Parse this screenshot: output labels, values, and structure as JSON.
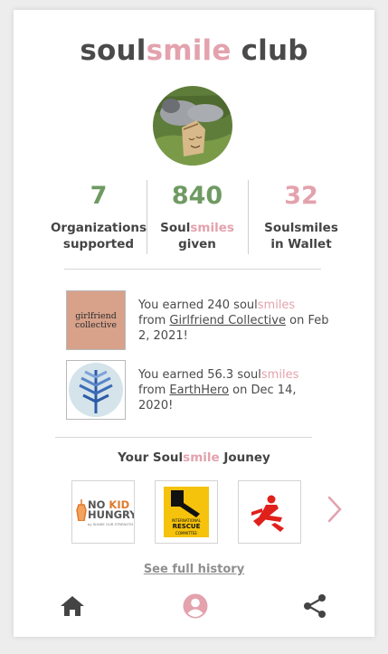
{
  "header": {
    "title_part1": "soul",
    "title_part2": "smile",
    "title_part3": " club"
  },
  "stats": [
    {
      "value": "7",
      "label_line1": "Organizations",
      "label_line2": "supported",
      "color": "#6f9a62"
    },
    {
      "value": "840",
      "label_pre": "Soul",
      "label_accent": "smiles",
      "label_line2": "given",
      "color": "#6f9a62"
    },
    {
      "value": "32",
      "label_line1": "Soulsmiles",
      "label_line2": "in Wallet",
      "color": "#e3a2ad"
    }
  ],
  "earnings": [
    {
      "logo_line1": "girlfriend",
      "logo_line2": "collective",
      "text_pre": "You earned 240 soul",
      "text_accent": "smiles",
      "text_from": "from ",
      "org_link": "Girlfriend Collective",
      "text_date": " on Feb 2, 2021!"
    },
    {
      "logo_icon": "tree-icon",
      "text_pre": "You earned 56.3 soul",
      "text_accent": "smiles",
      "text_from": "from ",
      "org_link": "EarthHero",
      "text_date": " on  Dec 14, 2020!"
    }
  ],
  "journey": {
    "title_pre": "Your Soul",
    "title_accent": "smile",
    "title_post": " Jouney",
    "orgs": [
      {
        "name_line1_a": "NO ",
        "name_line1_b": "KID",
        "name_line2": "HUNGRY",
        "tagline": "by SHARE OUR STRENGTH"
      },
      {
        "name_line1": "INTERNATIONAL",
        "name_line2": "RESCUE",
        "name_line3": "COMMITTEE"
      },
      {
        "icon": "msf-logo-icon"
      }
    ],
    "history_link": "See full history"
  },
  "nav": {
    "items": [
      "home-icon",
      "profile-icon",
      "share-icon"
    ],
    "active_color": "#e3a2ad"
  },
  "colors": {
    "accent_pink": "#e3a2ad",
    "accent_green": "#6f9a62"
  }
}
